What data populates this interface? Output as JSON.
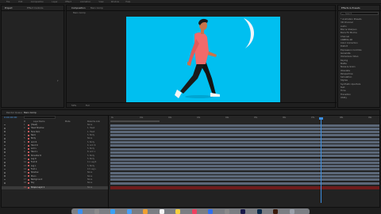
{
  "menu": [
    "File",
    "Edit",
    "Composition",
    "Layer",
    "Effect",
    "Animation",
    "View",
    "Window",
    "Help"
  ],
  "left_panel": {
    "tabs": [
      "Project",
      "Effect Controls"
    ]
  },
  "comp_panel": {
    "tabs": [
      "Composition",
      "Main Comp"
    ],
    "breadcrumb": "Main Comp",
    "zoom": "50%",
    "resolution": "Full"
  },
  "right_panel": {
    "tabs": [
      "Effects & Presets"
    ],
    "search_placeholder": "Search",
    "items": [
      "* Animation Presets",
      "3D Channel",
      "Audio",
      "Blur & Sharpen",
      "Boris FX Mocha",
      "Channel",
      "CINEMA 4D",
      "Color Correction",
      "Distort",
      "Expression Controls",
      "Generate",
      "Immersive Video",
      "Keying",
      "Matte",
      "Noise & Grain",
      "Obsolete",
      "Perspective",
      "Simulation",
      "Stylize",
      "Synthetic Aperture",
      "Text",
      "Time",
      "Transition",
      "Utility"
    ]
  },
  "timeline": {
    "tabs": [
      "Render Queue",
      "Main Comp"
    ],
    "timecode": "0:00:00:00",
    "columns": [
      "#",
      "Layer Name",
      "Mode",
      "Parent & Link"
    ],
    "ruler": [
      "0s",
      "01s",
      "02s",
      "03s",
      "04s",
      "05s",
      "06s",
      "07s",
      "08s",
      "09s"
    ],
    "layers": [
      {
        "num": "1",
        "name": "[Head]",
        "parent": "None",
        "color": "#c9595a"
      },
      {
        "num": "2",
        "name": "Head Shadow",
        "parent": "1. Head",
        "color": "#c9595a"
      },
      {
        "num": "3",
        "name": "Face Skin",
        "parent": "1. Head",
        "color": "#c9595a"
      },
      {
        "num": "4",
        "name": "Neck",
        "parent": "5. Body",
        "color": "#c9595a"
      },
      {
        "num": "5",
        "name": "Body",
        "parent": "None",
        "color": "#c9595a"
      },
      {
        "num": "6",
        "name": "Arm R",
        "parent": "5. Body",
        "color": "#c9595a"
      },
      {
        "num": "7",
        "name": "Hand R",
        "parent": "6. Arm R",
        "color": "#c9595a"
      },
      {
        "num": "8",
        "name": "Arm L",
        "parent": "5. Body",
        "color": "#c9595a"
      },
      {
        "num": "9",
        "name": "Hand L",
        "parent": "8. Arm L",
        "color": "#c9595a"
      },
      {
        "num": "10",
        "name": "Shoulder R",
        "parent": "5. Body",
        "color": "#c9595a"
      },
      {
        "num": "11",
        "name": "Leg R",
        "parent": "5. Body",
        "color": "#c9595a"
      },
      {
        "num": "12",
        "name": "Foot R",
        "parent": "11. Leg R",
        "color": "#c9595a"
      },
      {
        "num": "13",
        "name": "Leg L",
        "parent": "5. Body",
        "color": "#c9595a"
      },
      {
        "num": "14",
        "name": "Foot L",
        "parent": "13. Leg L",
        "color": "#c9595a"
      },
      {
        "num": "15",
        "name": "Shadow",
        "parent": "None",
        "color": "#c9595a"
      },
      {
        "num": "16",
        "name": "Moon",
        "parent": "None",
        "color": "#c9595a"
      },
      {
        "num": "17",
        "name": "Background",
        "parent": "None",
        "color": "#c9595a"
      },
      {
        "num": "18",
        "name": "Sky",
        "parent": "None",
        "color": "#c9595a"
      }
    ],
    "selected_layer": {
      "num": "19",
      "name": "Shape Layer 1",
      "parent": "None"
    }
  },
  "colors": {
    "comp_bg": "#00bff0",
    "shirt": "#f06a6a",
    "pants": "#1a1a1a",
    "moon": "#f2f5fa",
    "skin": "#c9744a",
    "track": "#5b6778",
    "selected_track": "#6e1c1c",
    "playhead": "#3d8fe0"
  },
  "dock_icons": [
    "finder-icon",
    "launchpad-icon",
    "safari-icon",
    "mail-icon",
    "photos-icon",
    "calendar-icon",
    "notes-icon",
    "music-icon",
    "appstore-icon",
    "settings-icon",
    "aftereffects-icon",
    "photoshop-icon",
    "illustrator-icon",
    "trash-icon"
  ]
}
